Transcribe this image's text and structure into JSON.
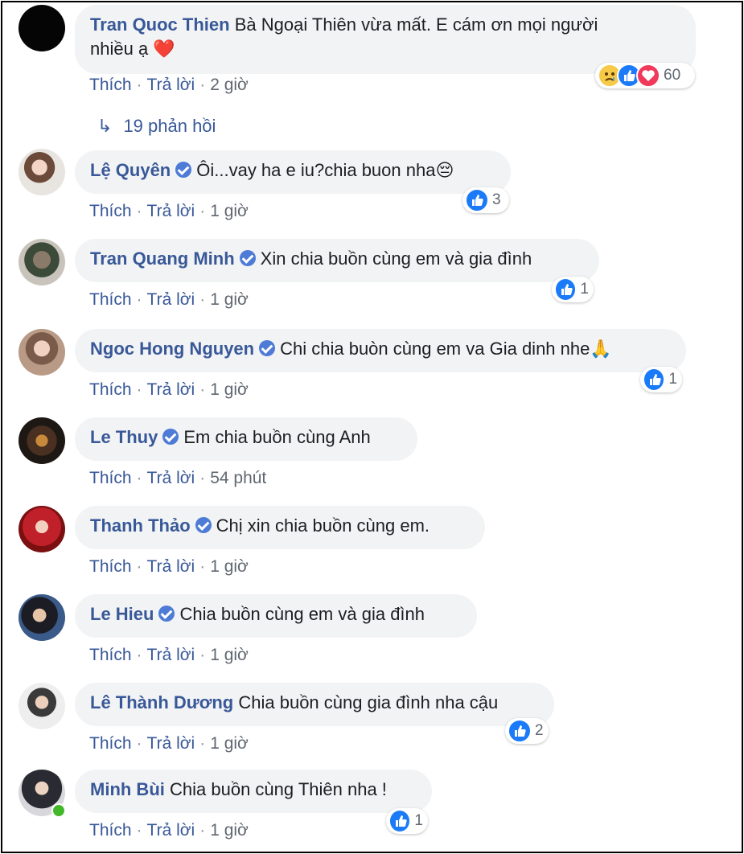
{
  "thread": {
    "top_comment": {
      "author": "Tran Quoc Thien",
      "text_line1": "Bà Ngoại Thiên vừa mất. E cám ơn mọi người",
      "text_line2": "nhiều ạ",
      "heart": "❤️",
      "reaction_count": "60",
      "actions": {
        "like": "Thích",
        "reply": "Trả lời",
        "time": "2 giờ"
      }
    },
    "replies_link": {
      "arrow": "↳",
      "label": "19 phản hồi"
    }
  },
  "comments": [
    {
      "author": "Lệ Quyên",
      "text": "Ôi...vay ha e iu?chia buon nha😔",
      "reactions": "3",
      "time": "1 giờ"
    },
    {
      "author": "Tran Quang Minh",
      "text": "Xin chia buồn cùng em và gia đình",
      "reactions": "1",
      "time": "1 giờ"
    },
    {
      "author": "Ngoc Hong Nguyen",
      "text": "Chi chia buòn cùng em va Gia dinh nhe🙏",
      "reactions": "1",
      "time": "1 giờ"
    },
    {
      "author": "Le Thuy",
      "text": "Em chia buồn cùng Anh",
      "time": "54 phút"
    },
    {
      "author": "Thanh Thảo",
      "text": "Chị xin chia buồn cùng em.",
      "time": "1 giờ"
    },
    {
      "author": "Le Hieu",
      "text": "Chia buồn cùng em và gia đình",
      "time": "1 giờ"
    },
    {
      "author": "Lê Thành Dương",
      "text": "Chia buồn cùng gia đình nha cậu",
      "reactions": "2",
      "time": "1 giờ"
    },
    {
      "author": "Minh Bùi",
      "text": "Chia buồn cùng Thiên nha !",
      "reactions": "1",
      "time": "1 giờ"
    }
  ],
  "labels": {
    "like": "Thích",
    "reply": "Trả lời"
  },
  "colors": {
    "link": "#385898",
    "bubble": "#f2f3f5",
    "like": "#1a7af8",
    "love": "#f0395b",
    "online": "#42b72a"
  }
}
